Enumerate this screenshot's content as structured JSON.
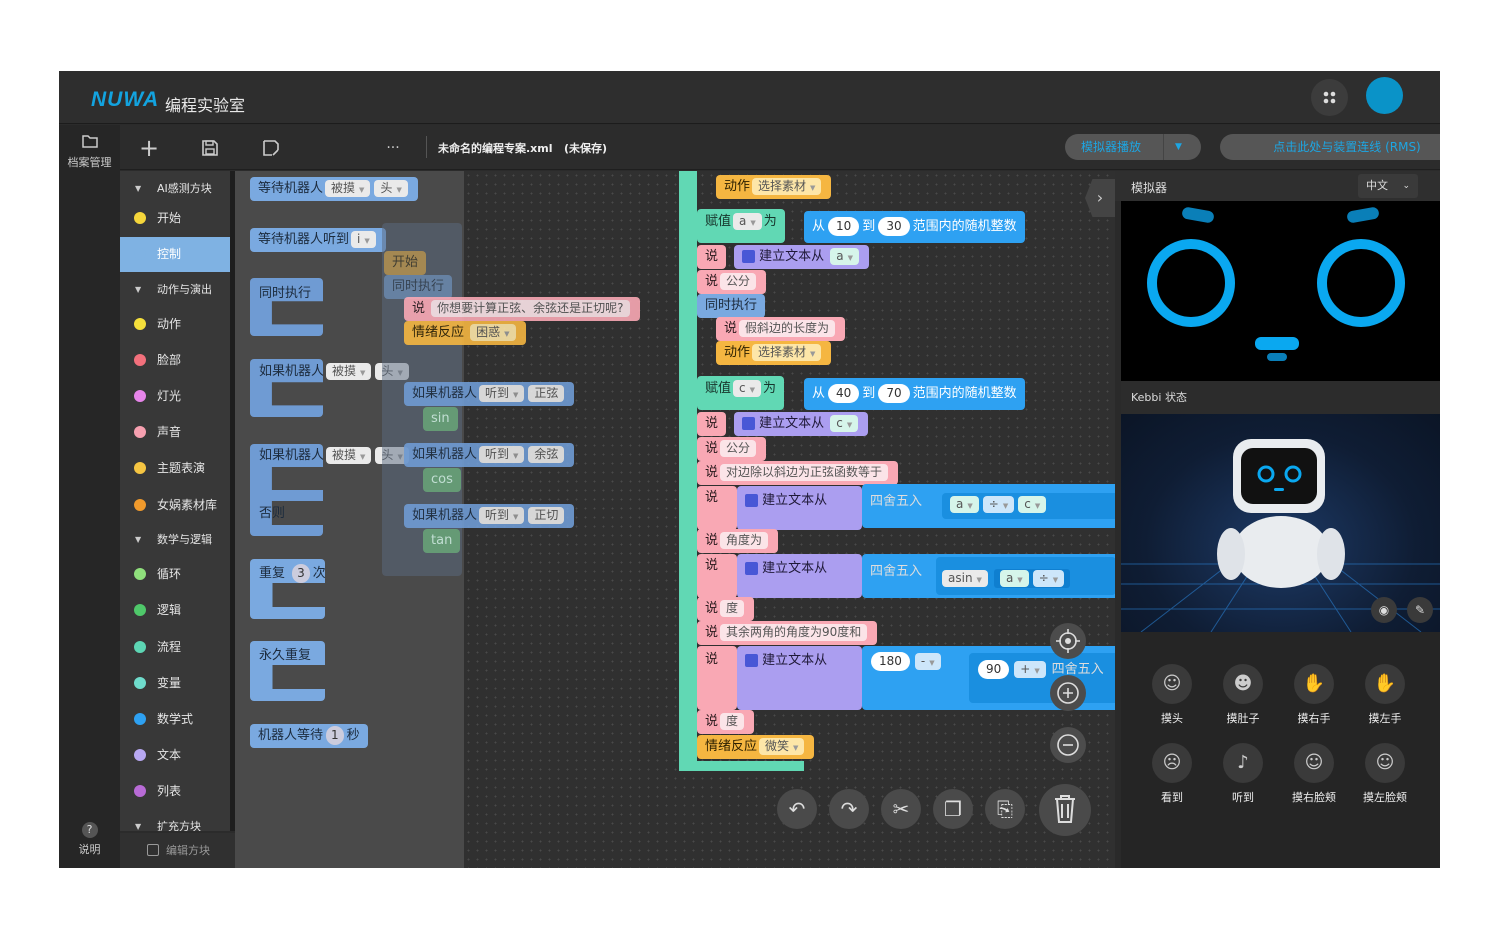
{
  "header": {
    "logo": "NUWA",
    "title": "编程实验室",
    "apps_icon": "grid-icon",
    "avatar_color": "#0a93c8"
  },
  "leftrail": {
    "files_label": "档案管理",
    "help_label": "说明",
    "help_icon": "?"
  },
  "toolbar": {
    "new_icon": "+",
    "save_icon": "save-icon",
    "saveas_icon": "save-as-icon",
    "more_icon": "···",
    "filename": "未命名的编程专案.xml",
    "unsaved": "(未保存)",
    "sim_play": "模拟器播放",
    "connect": "点击此处与装置连线 (RMS)"
  },
  "categories": [
    {
      "label": "AI感测方块",
      "type": "head"
    },
    {
      "label": "开始",
      "color": "#f5d63b"
    },
    {
      "label": "控制",
      "color": "#7fb2e3",
      "active": true
    },
    {
      "label": "动作与演出",
      "type": "head"
    },
    {
      "label": "动作",
      "color": "#f5e03b"
    },
    {
      "label": "脸部",
      "color": "#f2707c"
    },
    {
      "label": "灯光",
      "color": "#e785ea"
    },
    {
      "label": "声音",
      "color": "#f6a0b0"
    },
    {
      "label": "主题表演",
      "color": "#f5c542"
    },
    {
      "label": "女娲素材库",
      "color": "#f09a2c"
    },
    {
      "label": "数学与逻辑",
      "type": "head"
    },
    {
      "label": "循环",
      "color": "#8fe07c"
    },
    {
      "label": "逻辑",
      "color": "#4fc86a"
    },
    {
      "label": "流程",
      "color": "#5dd6b4"
    },
    {
      "label": "变量",
      "color": "#6fdccc"
    },
    {
      "label": "数学式",
      "color": "#2ea1f2"
    },
    {
      "label": "文本",
      "color": "#b8a8f2"
    },
    {
      "label": "列表",
      "color": "#b86bd6"
    },
    {
      "label": "扩充方块",
      "type": "head"
    }
  ],
  "edit_blocks": "编辑方块",
  "flyout": {
    "wait_touched": "等待机器人",
    "touched": "被摸",
    "head": "头",
    "wait_hear": "等待机器人听到",
    "hear_var": "i",
    "parallel": "同时执行",
    "if_robot": "如果机器人",
    "else": "否则",
    "repeat": "重复",
    "repeat_n": "3",
    "times": "次",
    "forever": "永久重复",
    "robot_wait": "机器人等待",
    "wait_n": "1",
    "seconds": "秒"
  },
  "ghost": {
    "start": "开始",
    "parallel": "同时执行",
    "say": "说",
    "question": "你想要计算正弦、余弦还是正切呢?",
    "emotion": "情绪反应",
    "confused": "困惑",
    "if_robot": "如果机器人",
    "hear": "听到",
    "sine": "正弦",
    "cosine": "余弦",
    "tangent": "正切",
    "sin": "sin",
    "cos": "cos",
    "tan": "tan"
  },
  "script": {
    "action": "动作",
    "select_material": "选择素材",
    "assign": "赋值",
    "as": "为",
    "from": "从",
    "to": "到",
    "rand_int": "范围内的随机整数",
    "var_a": "a",
    "a_min": "10",
    "a_max": "30",
    "var_c": "c",
    "c_min": "40",
    "c_max": "70",
    "say": "说",
    "build_text": "建立文本从",
    "cm": "公分",
    "parallel": "同时执行",
    "hyp_len": "假斜边的长度为",
    "opp_over_hyp": "对边除以斜边为正弦函数等于",
    "round": "四舍五入",
    "divide": "÷",
    "angle_is": "角度为",
    "asin": "asin",
    "deg": "度",
    "other_angles": "其余两角的角度为90度和",
    "n180": "180",
    "minus": "-",
    "n90": "90",
    "plus": "+",
    "emotion": "情绪反应",
    "smile": "微笑"
  },
  "simulator": {
    "title": "模拟器",
    "lang": "中文",
    "status": "Kebbi 状态",
    "face_color": "#0aa8f0"
  },
  "gestures": [
    {
      "label": "摸头",
      "icon": "touch-head-icon"
    },
    {
      "label": "摸肚子",
      "icon": "touch-belly-icon"
    },
    {
      "label": "摸右手",
      "icon": "touch-right-hand-icon"
    },
    {
      "label": "摸左手",
      "icon": "touch-left-hand-icon"
    },
    {
      "label": "看到",
      "icon": "see-icon"
    },
    {
      "label": "听到",
      "icon": "hear-icon"
    },
    {
      "label": "摸右脸颊",
      "icon": "touch-right-cheek-icon"
    },
    {
      "label": "摸左脸颊",
      "icon": "touch-left-cheek-icon"
    }
  ]
}
